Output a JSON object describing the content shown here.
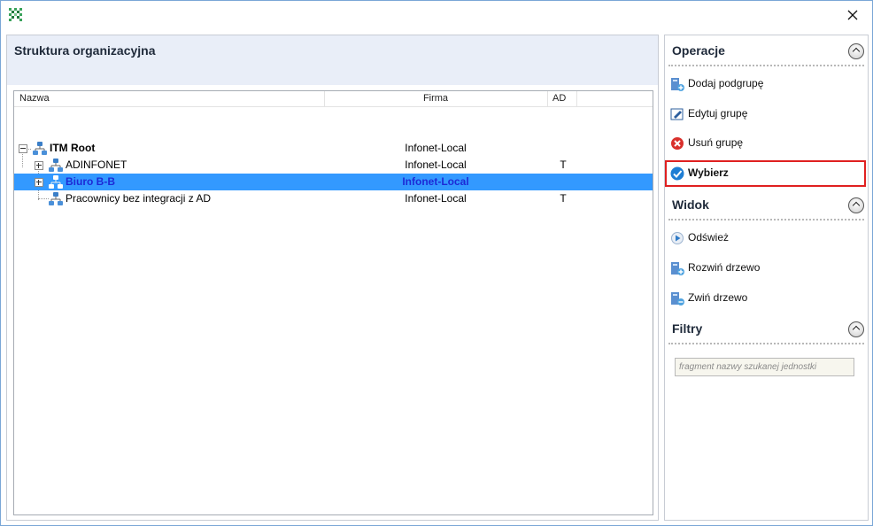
{
  "window": {
    "app_icon": "checker-app-icon",
    "close_symbol": "✕"
  },
  "left_panel": {
    "title": "Struktura organizacyjna",
    "columns": {
      "name": "Nazwa",
      "firma": "Firma",
      "ad": "AD"
    },
    "rows": [
      {
        "name": "ITM Root",
        "firma": "Infonet-Local",
        "ad": ""
      },
      {
        "name": "ADINFONET",
        "firma": "Infonet-Local",
        "ad": "T"
      },
      {
        "name": "Biuro B-B",
        "firma": "Infonet-Local",
        "ad": ""
      },
      {
        "name": "Pracownicy bez integracji z AD",
        "firma": "Infonet-Local",
        "ad": "T"
      }
    ],
    "selected_row": "Biuro B-B"
  },
  "right_panel": {
    "operacje": {
      "title": "Operacje",
      "actions": [
        {
          "label": "Dodaj podgrupę",
          "icon": "add-subgroup-icon"
        },
        {
          "label": "Edytuj grupę",
          "icon": "edit-group-icon"
        },
        {
          "label": "Usuń grupę",
          "icon": "delete-icon"
        },
        {
          "label": "Wybierz",
          "icon": "check-icon"
        }
      ]
    },
    "widok": {
      "title": "Widok",
      "actions": [
        {
          "label": "Odśwież",
          "icon": "refresh-icon"
        },
        {
          "label": "Rozwiń drzewo",
          "icon": "expand-tree-icon"
        },
        {
          "label": "Zwiń drzewo",
          "icon": "collapse-tree-icon"
        }
      ]
    },
    "filtry": {
      "title": "Filtry",
      "placeholder": "fragment nazwy szukanej jednostki",
      "value": ""
    }
  },
  "colors": {
    "selection": "#3399ff",
    "selected_text": "#1d2ad6",
    "highlight_border": "#e02020",
    "header_bg": "#e9eef8"
  }
}
